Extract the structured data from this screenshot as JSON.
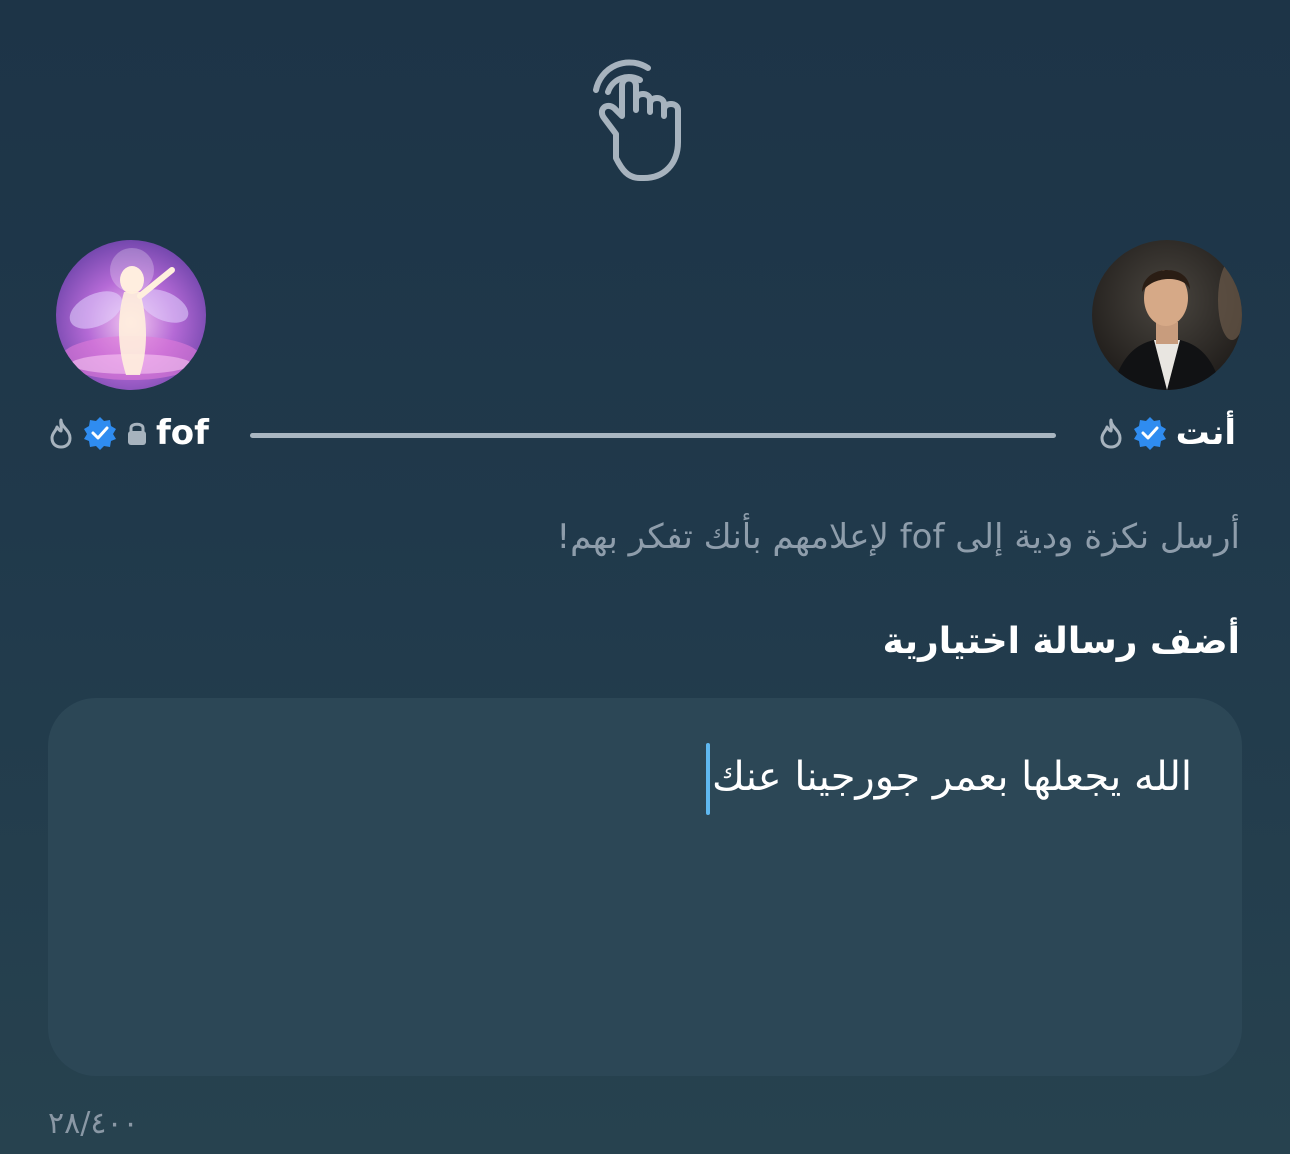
{
  "icons": {
    "poke": "pointing-hand-icon",
    "verified": "verified-badge-icon",
    "streak": "flame-icon",
    "private": "lock-icon"
  },
  "colors": {
    "verified": "#2f8cf0",
    "connector": "#a9b6c1",
    "caret": "#5fb8f0"
  },
  "me": {
    "name": "أنت",
    "avatar": "avatar-me-photo"
  },
  "other": {
    "name": "fof",
    "avatar": "avatar-other-photo"
  },
  "subtitle": "أرسل نكزة ودية إلى fof لإعلامهم بأنك تفكر بهم!",
  "message": {
    "label": "أضف رسالة اختيارية",
    "value": "الله يجعلها بعمر جورجينا عنك",
    "counter": "٢٨/٤٠٠"
  }
}
